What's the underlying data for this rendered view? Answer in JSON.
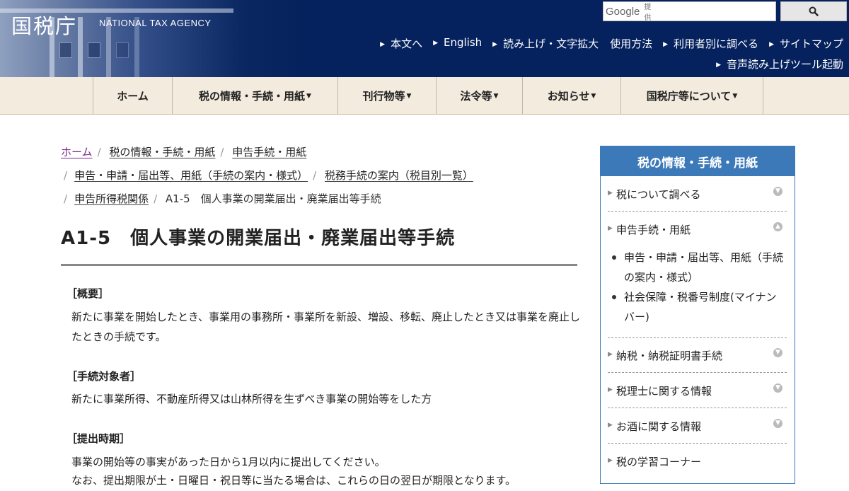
{
  "header": {
    "logo_text": "国税庁",
    "logo_en": "NATIONAL TAX AGENCY",
    "search": {
      "brand": "Google",
      "provided": "提供",
      "placeholder": ""
    },
    "util_links": [
      "本文へ",
      "English",
      "読み上げ・文字拡大",
      "使用方法",
      "利用者別に調べる",
      "サイトマップ"
    ],
    "reader_link": "音声読み上げツール起動"
  },
  "nav": {
    "items": [
      {
        "label": "ホーム",
        "dropdown": false
      },
      {
        "label": "税の情報・手続・用紙",
        "dropdown": true
      },
      {
        "label": "刊行物等",
        "dropdown": true
      },
      {
        "label": "法令等",
        "dropdown": true
      },
      {
        "label": "お知らせ",
        "dropdown": true
      },
      {
        "label": "国税庁等について",
        "dropdown": true
      }
    ]
  },
  "breadcrumb": {
    "items": [
      "ホーム",
      "税の情報・手続・用紙",
      "申告手続・用紙",
      "申告・申請・届出等、用紙（手続の案内・様式）",
      "税務手続の案内（税目別一覧）",
      "申告所得税関係",
      "A1-5　個人事業の開業届出・廃業届出等手続"
    ]
  },
  "page": {
    "title": "A1-5　個人事業の開業届出・廃業届出等手続",
    "sections": [
      {
        "heading": "［概要］",
        "body": "新たに事業を開始したとき、事業用の事務所・事業所を新設、増設、移転、廃止したとき又は事業を廃止したときの手続です。"
      },
      {
        "heading": "［手続対象者］",
        "body": "新たに事業所得、不動産所得又は山林所得を生ずべき事業の開始等をした方"
      },
      {
        "heading": "［提出時期］",
        "body_lines": [
          "事業の開始等の事実があった日から1月以内に提出してください。",
          "なお、提出期限が土・日曜日・祝日等に当たる場合は、これらの日の翌日が期限となります。"
        ]
      }
    ]
  },
  "sidebar": {
    "heading": "税の情報・手続・用紙",
    "items": [
      {
        "label": "税について調べる",
        "state": "collapsed"
      },
      {
        "label": "申告手続・用紙",
        "state": "expanded"
      },
      {
        "label": "納税・納税証明書手続",
        "state": "collapsed"
      },
      {
        "label": "税理士に関する情報",
        "state": "collapsed"
      },
      {
        "label": "お酒に関する情報",
        "state": "collapsed"
      },
      {
        "label": "税の学習コーナー",
        "state": "none"
      }
    ],
    "subitems": [
      "申告・申請・届出等、用紙（手続の案内・様式）",
      "社会保障・税番号制度(マイナンバー)"
    ]
  },
  "colors": {
    "header_bg": "#06225e",
    "nav_bg": "#f3ebdd",
    "sidebar_accent": "#3b79b8",
    "home_link": "#7b2a8c"
  }
}
